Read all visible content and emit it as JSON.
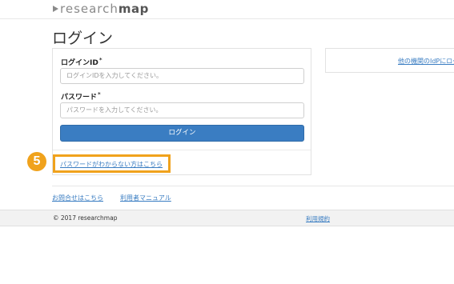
{
  "header": {
    "logo_light": "research",
    "logo_bold": "map"
  },
  "page": {
    "title": "ログイン"
  },
  "login_form": {
    "id_label": "ログインID",
    "id_required_mark": "*",
    "id_placeholder": "ログインIDを入力してください。",
    "password_label": "パスワード",
    "password_required_mark": "*",
    "password_placeholder": "パスワードを入力してください。",
    "submit_label": "ログイン",
    "forgot_password_link": "パスワードがわからない方はこちら"
  },
  "annotation": {
    "step_number": "5",
    "highlight_color": "#f0a21c"
  },
  "idp": {
    "link_label": "他の機関のIdPにログイン"
  },
  "footer_links": {
    "contact": "お問合せはこちら",
    "manual": "利用者マニュアル"
  },
  "footer": {
    "copyright": "© 2017 researchmap",
    "terms": "利用規約"
  },
  "colors": {
    "accent": "#3a7dc2",
    "badge": "#f0a21c"
  }
}
